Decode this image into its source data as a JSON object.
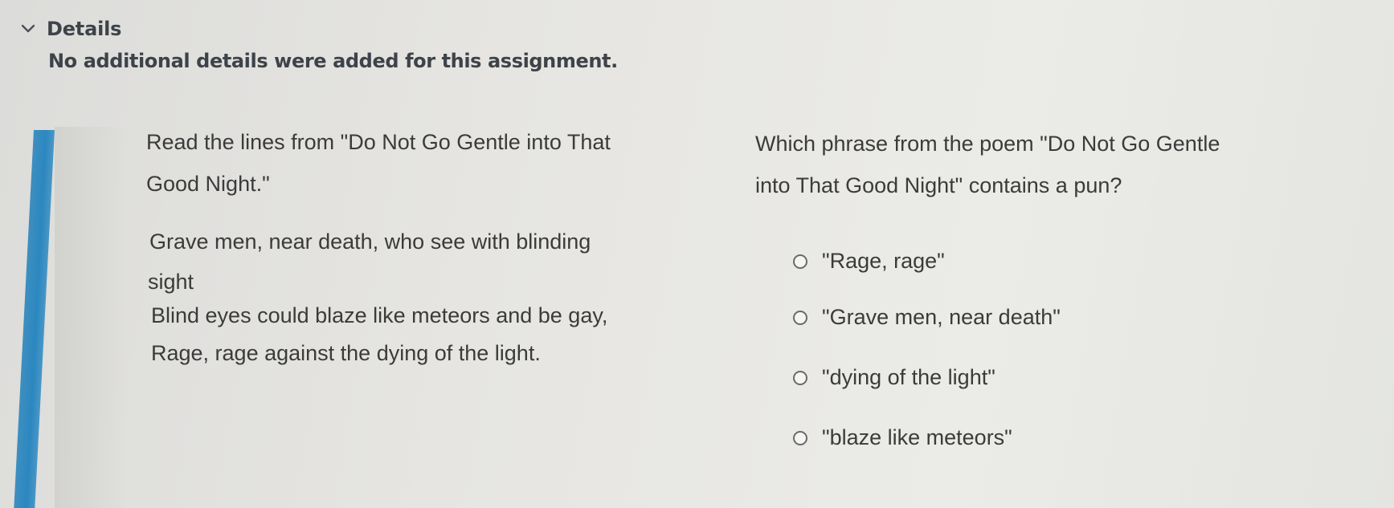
{
  "details": {
    "title": "Details",
    "description": "No additional details were added for this assignment."
  },
  "icons": {
    "expand": "chevron-down-icon",
    "option": "radio-circle-icon"
  },
  "colors": {
    "accent": "#2b87c0",
    "text": "#3b3b3b",
    "header_text": "#3d4349"
  },
  "passage": {
    "intro_line_1": "Read the lines from \"Do Not Go Gentle into That",
    "intro_line_2": "Good Night.\"",
    "poem_lines": [
      "Grave men, near death, who see with blinding",
      "sight",
      "Blind eyes could blaze like meteors and be gay,",
      "Rage, rage against the dying of the light."
    ]
  },
  "question": {
    "line_1": "Which phrase from the poem \"Do Not Go Gentle",
    "line_2": "into That Good Night\" contains a pun?"
  },
  "options": [
    {
      "label": "\"Rage, rage\""
    },
    {
      "label": "\"Grave men, near death\""
    },
    {
      "label": "\"dying of the light\""
    },
    {
      "label": "\"blaze like meteors\""
    }
  ]
}
